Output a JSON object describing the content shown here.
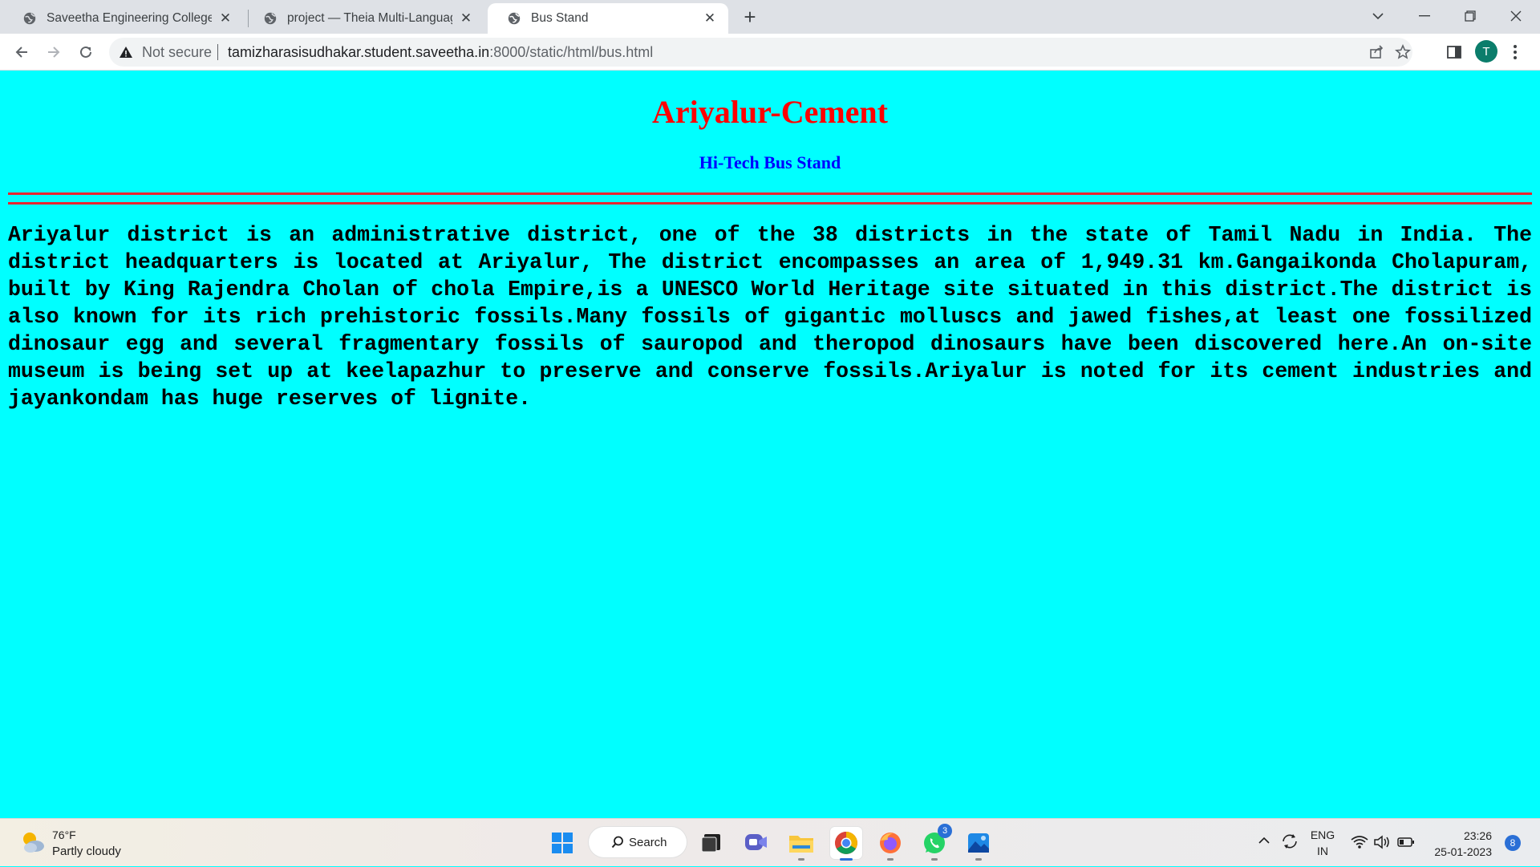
{
  "browser": {
    "tabs": [
      {
        "title": "Saveetha Engineering College",
        "icon": "globe-icon"
      },
      {
        "title": "project — Theia Multi-Language",
        "icon": "globe-icon"
      },
      {
        "title": "Bus Stand",
        "icon": "globe-icon",
        "active": true
      }
    ],
    "security_label": "Not secure",
    "url_host": "tamizharasisudhakar.student.saveetha.in",
    "url_rest": ":8000/static/html/bus.html",
    "profile_initial": "T"
  },
  "page": {
    "heading": "Ariyalur-Cement",
    "subheading": "Hi-Tech Bus Stand",
    "heading_color": "#ff0000",
    "subheading_color": "#0000ff",
    "background_color": "#00ffff",
    "rule_color": "#e8242f",
    "paragraph": "Ariyalur district is an administrative district, one of the 38 districts in the state of Tamil Nadu in India. The district headquarters is located at Ariyalur, The district encompasses an area of 1,949.31 km.Gangaikonda Cholapuram, built by King Rajendra Cholan of chola Empire,is a UNESCO World Heritage site situated in this district.The district is also known for its rich prehistoric fossils.Many fossils of gigantic molluscs and jawed fishes,at least one fossilized dinosaur egg and several fragmentary fossils of sauropod and theropod dinosaurs have been discovered here.An on-site museum is being set up at keelapazhur to preserve and conserve fossils.Ariyalur is noted for its cement industries and jayankondam has huge reserves of lignite."
  },
  "taskbar": {
    "weather_temp": "76°F",
    "weather_desc": "Partly cloudy",
    "search_label": "Search",
    "whatsapp_badge": "3",
    "lang_line1": "ENG",
    "lang_line2": "IN",
    "time": "23:26",
    "date": "25-01-2023",
    "notification_count": "8"
  }
}
